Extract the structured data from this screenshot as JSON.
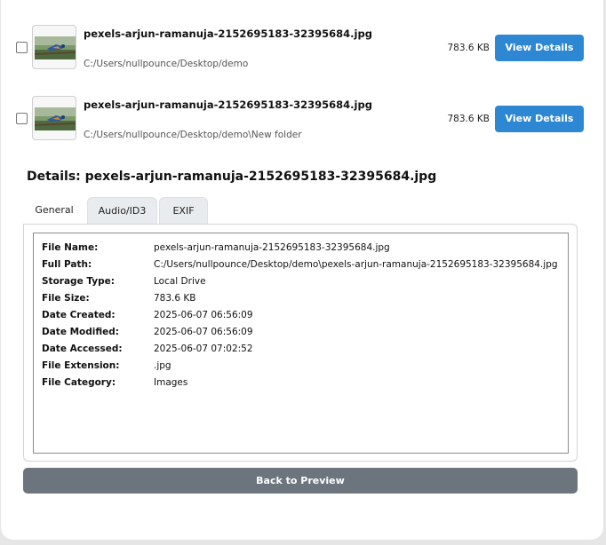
{
  "files": [
    {
      "name": "pexels-arjun-ramanuja-2152695183-32395684.jpg",
      "path": "C:/Users/nullpounce/Desktop/demo",
      "size": "783.6 KB",
      "button": "View Details"
    },
    {
      "name": "pexels-arjun-ramanuja-2152695183-32395684.jpg",
      "path": "C:/Users/nullpounce/Desktop/demo\\New folder",
      "size": "783.6 KB",
      "button": "View Details"
    }
  ],
  "details": {
    "title": "Details: pexels-arjun-ramanuja-2152695183-32395684.jpg",
    "tabs": [
      "General",
      "Audio/ID3",
      "EXIF"
    ],
    "active_tab": "General",
    "properties": [
      {
        "key": "File Name:",
        "value": "pexels-arjun-ramanuja-2152695183-32395684.jpg"
      },
      {
        "key": "Full Path:",
        "value": "C:/Users/nullpounce/Desktop/demo\\pexels-arjun-ramanuja-2152695183-32395684.jpg"
      },
      {
        "key": "Storage Type:",
        "value": "Local Drive"
      },
      {
        "key": "File Size:",
        "value": "783.6 KB"
      },
      {
        "key": "Date Created:",
        "value": "2025-06-07 06:56:09"
      },
      {
        "key": "Date Modified:",
        "value": "2025-06-07 06:56:09"
      },
      {
        "key": "Date Accessed:",
        "value": "2025-06-07 07:02:52"
      },
      {
        "key": "File Extension:",
        "value": ".jpg"
      },
      {
        "key": "File Category:",
        "value": "Images"
      }
    ]
  },
  "back_button": "Back to Preview",
  "colors": {
    "primary_button": "#2d87d3",
    "secondary_button": "#6c757d"
  },
  "icons": {
    "thumbnail": "bird-photo-thumbnail"
  }
}
